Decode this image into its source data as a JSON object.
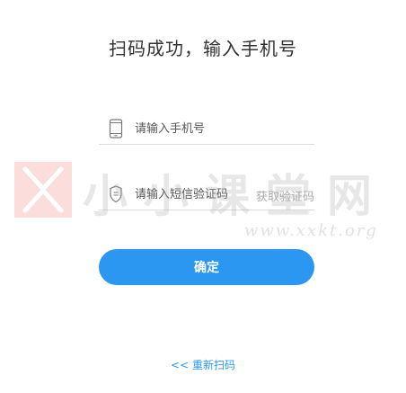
{
  "header": {
    "title": "扫码成功，输入手机号"
  },
  "phone_field": {
    "icon": "phone-icon",
    "placeholder": "请输入手机号",
    "value": ""
  },
  "sms_field": {
    "icon": "shield-icon",
    "placeholder": "请输入短信验证码",
    "value": "",
    "get_code_label": "获取验证码"
  },
  "actions": {
    "confirm_label": "确定",
    "rescan_label": "<< 重新扫码"
  },
  "watermark": {
    "logo": "x-logo",
    "text": "小小课堂网",
    "url": "www.xxkt.org"
  },
  "colors": {
    "accent": "#2b97f0",
    "border": "#dddddd",
    "title_text": "#333333",
    "muted_text": "#aaaaaa"
  }
}
